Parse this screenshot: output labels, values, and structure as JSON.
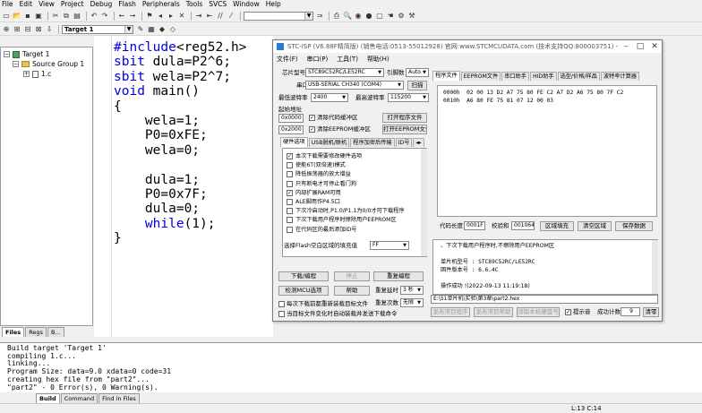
{
  "menubar": [
    "File",
    "Edit",
    "View",
    "Project",
    "Debug",
    "Flash",
    "Peripherals",
    "Tools",
    "SVCS",
    "Window",
    "Help"
  ],
  "toolbar": {
    "target_combo": "Target 1"
  },
  "project": {
    "target": "Target 1",
    "group": "Source Group 1",
    "file": "1.c",
    "tabs": [
      "Files",
      "Regs",
      "B..."
    ]
  },
  "editor": {
    "lines": [
      {
        "kw": "#include",
        "rest": "<reg52.h>"
      },
      {
        "kw": "sbit",
        "rest": " dula=P2^6;"
      },
      {
        "kw": "sbit",
        "rest": " wela=P2^7;"
      },
      {
        "kw": "void",
        "rest": " main()"
      },
      {
        "kw": "",
        "rest": "{"
      },
      {
        "kw": "",
        "rest": "    wela=1;"
      },
      {
        "kw": "",
        "rest": "    P0=0xFE;"
      },
      {
        "kw": "",
        "rest": "    wela=0;"
      },
      {
        "kw": "",
        "rest": ""
      },
      {
        "kw": "",
        "rest": "    dula=1;"
      },
      {
        "kw": "",
        "rest": "    P0=0x7F;"
      },
      {
        "kw": "",
        "rest": "    dula=0;"
      },
      {
        "kw": "",
        "rest": "    while(1);",
        "kwinline": "while"
      },
      {
        "kw": "",
        "rest": "}"
      }
    ]
  },
  "stc": {
    "title": "STC-ISP (V6.88F精简版) (销售电话:0513-55012928) 官网:www.STCMCUDATA.com (技术支持QQ:800003751) -",
    "menu": [
      "文件(F)",
      "串口(P)",
      "工具(T)",
      "帮助(H)"
    ],
    "chip_label": "芯片型号",
    "chip_value": "STC89C52RC/LE52RC",
    "pins_label": "引脚数",
    "pins_value": "Auto",
    "port_label": "串口",
    "port_value": "USB-SERIAL CH340 (COM4)",
    "scan_btn": "扫描",
    "min_baud_label": "最低波特率",
    "min_baud_value": "2400",
    "max_baud_label": "最高波特率",
    "max_baud_value": "115200",
    "start_addr_label": "起始地址",
    "addr1": "0x0000",
    "clear_code": "清除代码缓冲区",
    "open_prog_btn": "打开程序文件",
    "addr2": "0x2000",
    "clear_eeprom": "清除EEPROM缓冲区",
    "open_eeprom_btn": "打开EEPROM文件",
    "left_tabs": [
      "硬件选项",
      "USB脱机/联机",
      "程序加密后传输",
      "ID号"
    ],
    "options": [
      {
        "checked": true,
        "text": "本次下载需要修改硬件选项"
      },
      {
        "checked": false,
        "text": "使能6T(双倍速)模式"
      },
      {
        "checked": false,
        "text": "降低振荡器的放大增益"
      },
      {
        "checked": false,
        "text": "只有断电才可停止看门狗"
      },
      {
        "checked": true,
        "text": "内部扩展RAM可用"
      },
      {
        "checked": false,
        "text": "ALE脚用作P4.5口"
      },
      {
        "checked": false,
        "text": "下次冷启动时,P1.0/P1.1为0/0才可下载程序"
      },
      {
        "checked": false,
        "text": "下次下载用户程序时擦除用户EEPROM区"
      },
      {
        "checked": false,
        "text": "在代码区的最后添加ID号"
      }
    ],
    "fill_label": "选择Flash空白区域的填充值",
    "fill_value": "FF",
    "download_btn": "下载/编程",
    "stop_btn": "停止",
    "reprogram_btn": "重复编程",
    "detect_btn": "检测MCU选项",
    "help_btn": "帮助",
    "repeat_delay_label": "重复延时",
    "repeat_delay_value": "3 秒",
    "repeat_count_label": "重复次数",
    "repeat_count_value": "无限",
    "cb_reload": "每次下载前都重新装载目标文件",
    "cb_autosend": "当目标文件变化时自动装载并发送下载命令",
    "right_tabs": [
      "程序文件",
      "EEPROM文件",
      "串口助手",
      "HID助手",
      "选型/价格/样品",
      "波特率计算器"
    ],
    "hex_rows": [
      {
        "addr": "0000h",
        "bytes": "02 00 13 D2 A7 75 80 FE C2 A7 D2 A6 75 80 7F C2"
      },
      {
        "addr": "0010h",
        "bytes": "A6 80 FE 75 81 07 12 00 03"
      }
    ],
    "code_len_label": "代码长度",
    "code_len_value": "0001F",
    "checksum_label": "校验和",
    "checksum_value": "001064",
    "fill_btn": "区域填充",
    "clear_btn": "清空区域",
    "save_btn": "保存数据",
    "info_lines": [
      "、下次下载用户程序时,不擦除用户EEPROM区",
      "",
      "单片机型号 : STC89C52RC/LE52RC",
      "固件版本号 : 6.6.4C",
      "",
      "操作成功 !(2022-09-13 11:19:18)"
    ],
    "path": "E:\\51单片机\\实验\\第3章\\part2.hex",
    "publish_prog_btn": "发布项目程序",
    "publish_help_btn": "发布项目帮助",
    "read_serial_btn": "读取本机硬盘号",
    "beep_label": "提示音",
    "success_label": "成功计数",
    "success_value": "9",
    "clear_count_btn": "清零"
  },
  "output": {
    "lines": [
      "Build target 'Target 1'",
      "compiling 1.c...",
      "linking...",
      "Program Size: data=9.0 xdata=0 code=31",
      "creating hex file from \"part2\"...",
      "\"part2\" - 0 Error(s), 0 Warning(s)."
    ],
    "tabs": [
      "Build",
      "Command",
      "Find in Files"
    ]
  },
  "status": {
    "position": "L:13 C:14"
  }
}
